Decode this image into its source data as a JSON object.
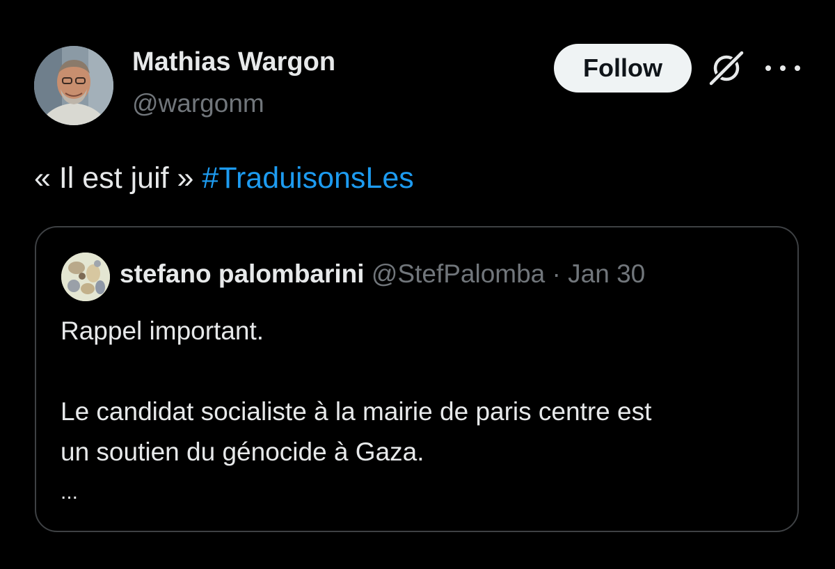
{
  "author": {
    "name": "Mathias Wargon",
    "handle": "@wargonm"
  },
  "actions": {
    "follow_label": "Follow"
  },
  "tweet": {
    "text_prefix": "« Il est juif » ",
    "hashtag": "#TraduisonsLes"
  },
  "quoted_tweet": {
    "name": "stefano palombarini",
    "handle": "@StefPalomba",
    "separator": "·",
    "date": "Jan 30",
    "line1": "Rappel important.",
    "line2": "Le candidat socialiste à la mairie de paris centre est",
    "line3": "un soutien du génocide à Gaza.",
    "ellipsis": "..."
  },
  "icons": {
    "grok": "grok-icon",
    "more": "more-icon"
  },
  "colors": {
    "background": "#000000",
    "text": "#e7e9ea",
    "secondary_text": "#71767b",
    "link": "#1d9bf0",
    "button_bg": "#eff3f4",
    "border": "#3e4144"
  }
}
